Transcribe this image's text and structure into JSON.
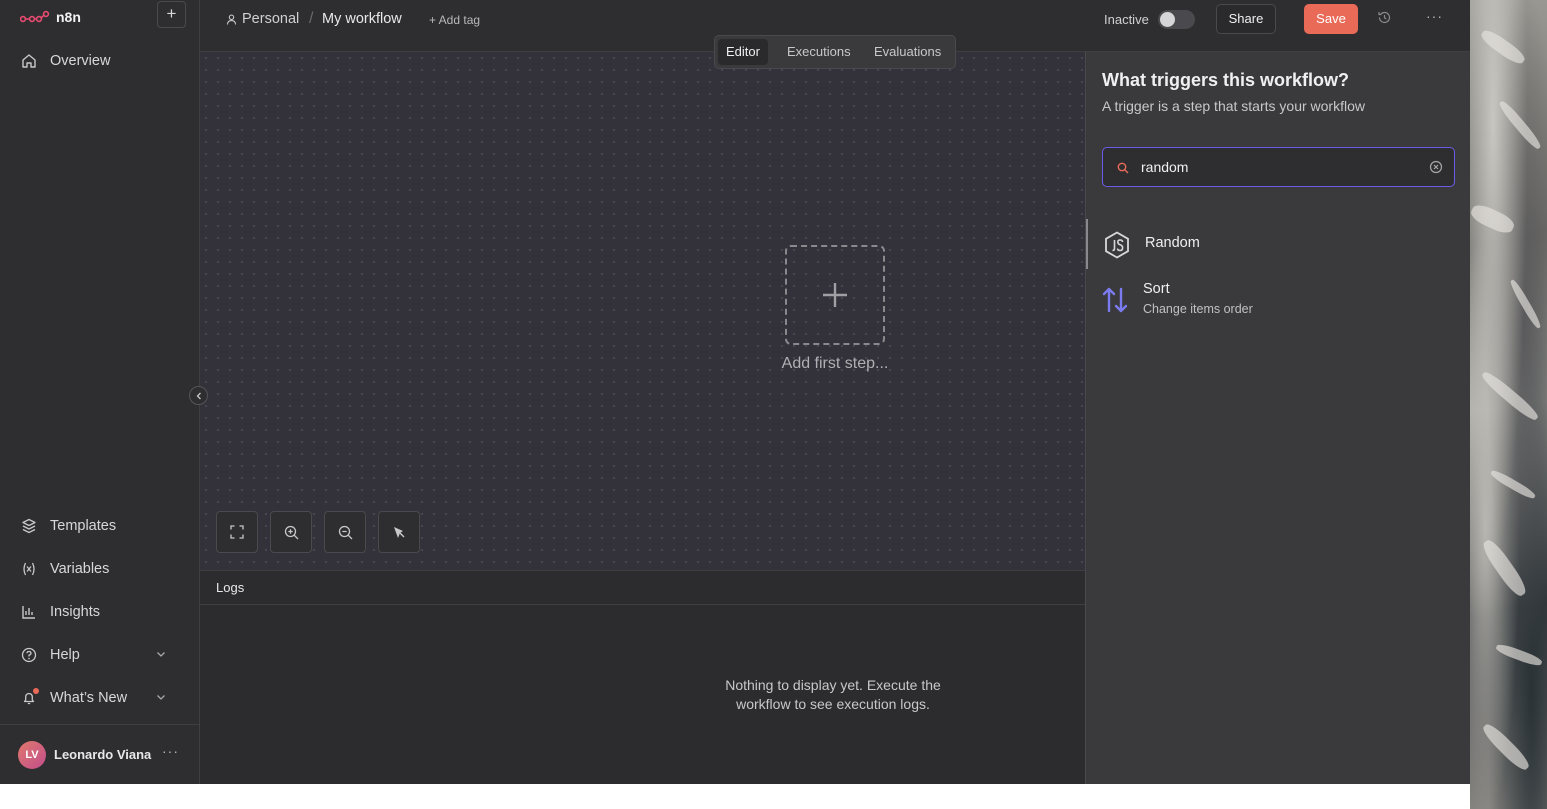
{
  "app": {
    "logo_text": "n8n"
  },
  "sidebar": {
    "new_button": "+",
    "top_items": [
      {
        "label": "Overview",
        "icon": "home-icon"
      }
    ],
    "bottom_items": [
      {
        "label": "Templates",
        "icon": "templates-icon"
      },
      {
        "label": "Variables",
        "icon": "variables-icon"
      },
      {
        "label": "Insights",
        "icon": "insights-icon"
      },
      {
        "label": "Help",
        "icon": "help-icon"
      },
      {
        "label": "What’s New",
        "icon": "bell-icon"
      }
    ],
    "user": {
      "initials": "LV",
      "name": "Leonardo Viana"
    }
  },
  "header": {
    "project": "Personal",
    "separator": "/",
    "workflow_name": "My workflow",
    "add_tag": "+ Add tag",
    "status_label": "Inactive",
    "share_label": "Share",
    "save_label": "Save"
  },
  "tabs": [
    "Editor",
    "Executions",
    "Evaluations"
  ],
  "active_tab": "Editor",
  "canvas": {
    "add_first_step": "Add first step..."
  },
  "logs": {
    "title": "Logs",
    "empty_line1": "Nothing to display yet. Execute the",
    "empty_line2": "workflow to see execution logs."
  },
  "node_creator": {
    "title": "What triggers this workflow?",
    "subtitle": "A trigger is a step that starts your workflow",
    "search_value": "random",
    "results": [
      {
        "name": "Random",
        "description": "",
        "icon": "nodejs-icon"
      },
      {
        "name": "Sort",
        "description": "Change items order",
        "icon": "sort-arrows-icon"
      }
    ]
  },
  "colors": {
    "accent": "#ea6a58",
    "focus": "#6b5ce7",
    "sort_icon": "#7b7bf0"
  }
}
